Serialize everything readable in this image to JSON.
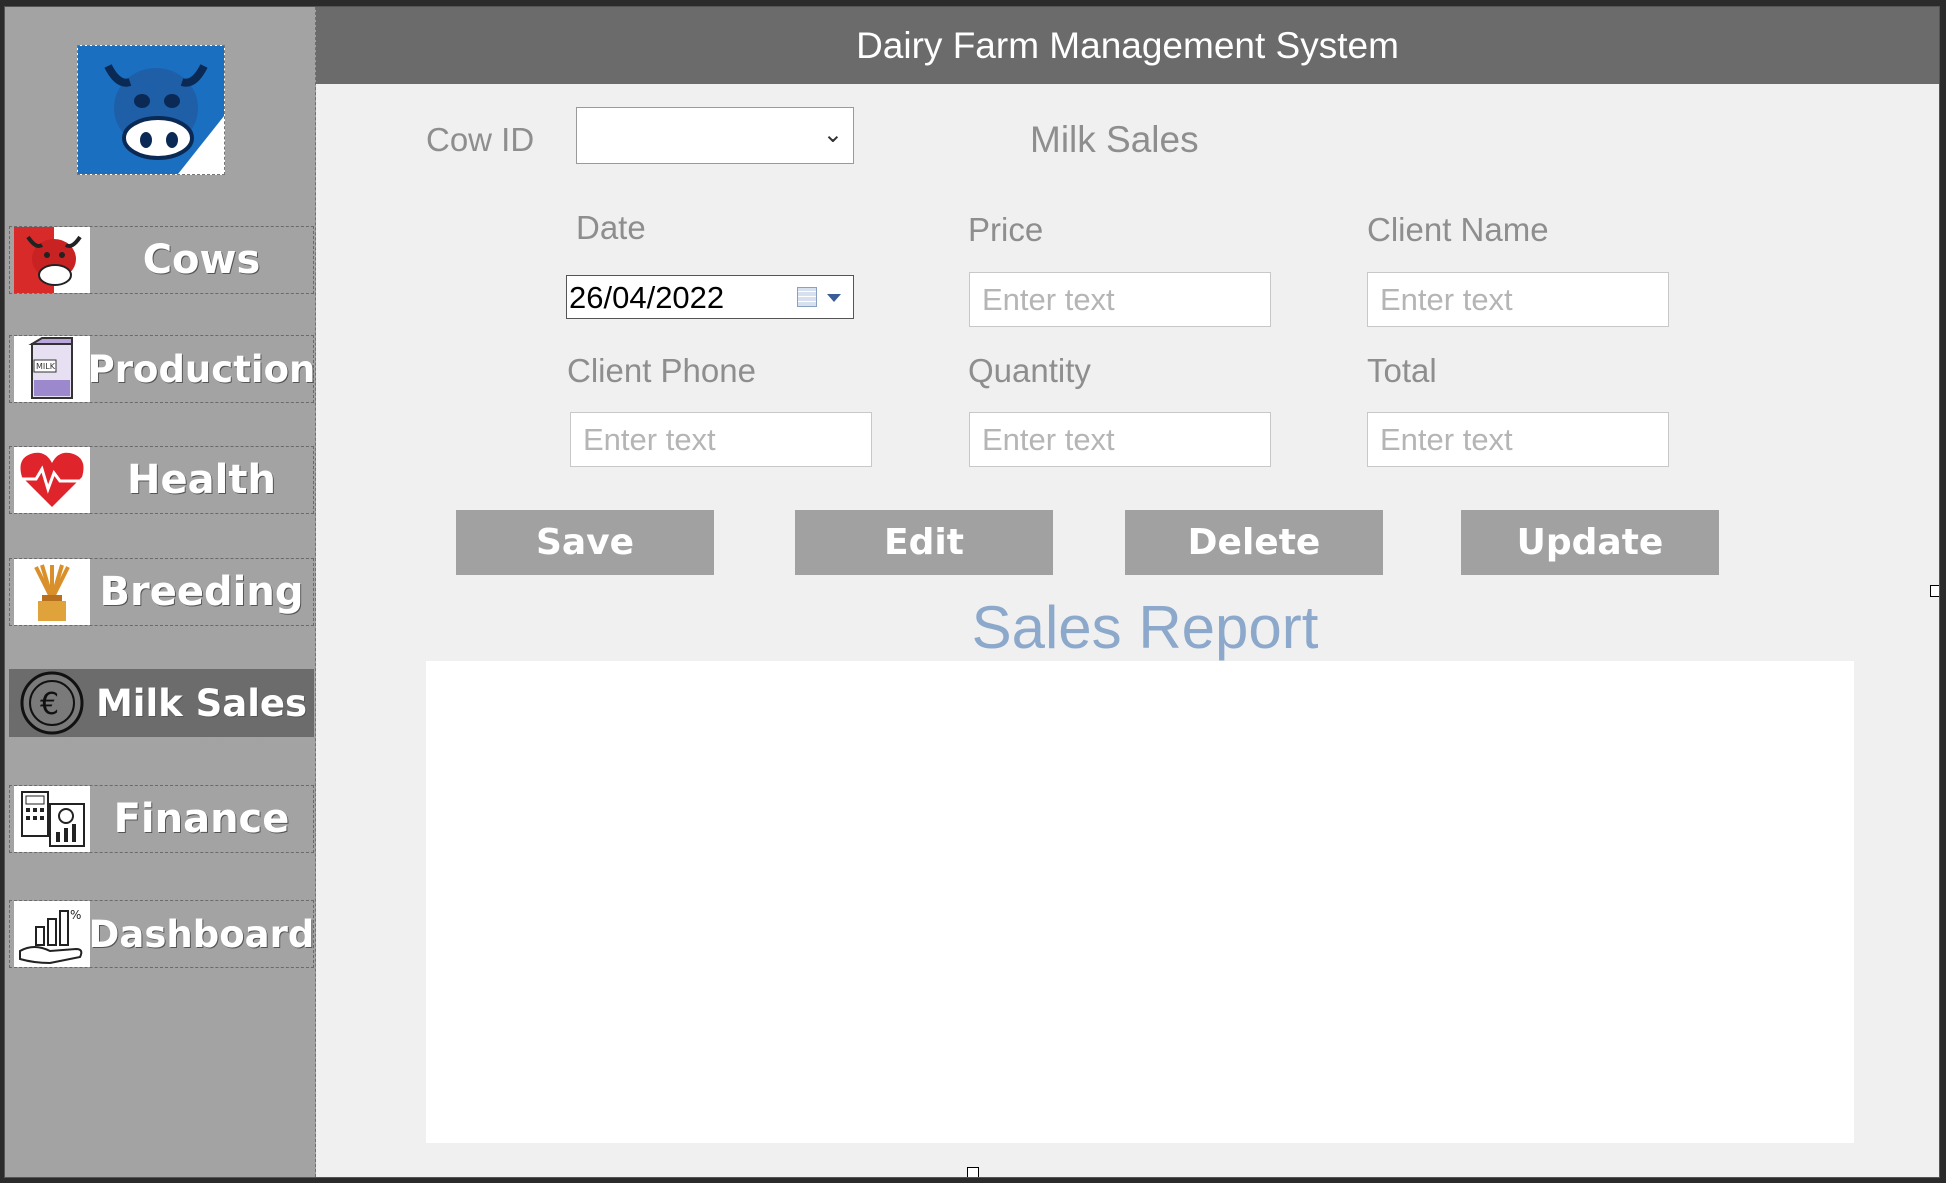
{
  "app": {
    "title": "Dairy Farm Management System"
  },
  "sidebar": {
    "logo_icon": "cow-logo-icon",
    "items": [
      {
        "label": "Cows",
        "icon": "cow-icon",
        "active": false
      },
      {
        "label": "Production",
        "icon": "milk-carton-icon",
        "active": false
      },
      {
        "label": "Health",
        "icon": "heart-pulse-icon",
        "active": false
      },
      {
        "label": "Breeding",
        "icon": "wheat-icon",
        "active": false
      },
      {
        "label": "Milk Sales",
        "icon": "euro-coin-icon",
        "active": true
      },
      {
        "label": "Finance",
        "icon": "calculator-chart-icon",
        "active": false
      },
      {
        "label": "Dashboard",
        "icon": "chart-hand-icon",
        "active": false
      }
    ]
  },
  "form": {
    "section_title": "Milk Sales",
    "cow_id": {
      "label": "Cow ID",
      "value": ""
    },
    "date": {
      "label": "Date",
      "value": "26/04/2022"
    },
    "price": {
      "label": "Price",
      "placeholder": "Enter text"
    },
    "client_name": {
      "label": "Client Name",
      "placeholder": "Enter text"
    },
    "client_phone": {
      "label": "Client Phone",
      "placeholder": "Enter text"
    },
    "quantity": {
      "label": "Quantity",
      "placeholder": "Enter text"
    },
    "total": {
      "label": "Total",
      "placeholder": "Enter text"
    }
  },
  "buttons": {
    "save": "Save",
    "edit": "Edit",
    "delete": "Delete",
    "update": "Update"
  },
  "report": {
    "title": "Sales Report"
  },
  "colors": {
    "header": "#6b6b6b",
    "sidebar": "#a3a3a3",
    "active_item": "#6c6c6c",
    "report_title": "#8ca9cc",
    "button": "#a1a1a1"
  }
}
